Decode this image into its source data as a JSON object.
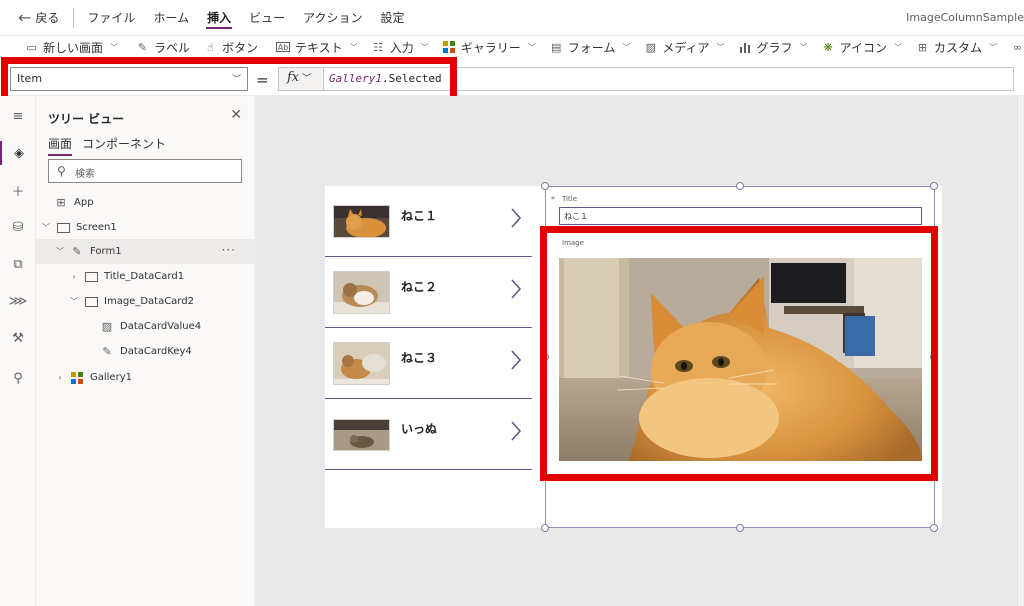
{
  "topbar": {
    "back_label": "戻る",
    "menu": [
      "ファイル",
      "ホーム",
      "挿入",
      "ビュー",
      "アクション",
      "設定"
    ],
    "active_menu": "挿入",
    "app_name": "ImageColumnSample"
  },
  "ribbon": {
    "new_screen": "新しい画面",
    "label": "ラベル",
    "button": "ボタン",
    "text": "テキスト",
    "input": "入力",
    "gallery": "ギャラリー",
    "form": "フォーム",
    "media": "メディア",
    "chart": "グラフ",
    "icon": "アイコン",
    "custom": "カスタム"
  },
  "formula_bar": {
    "property": "Item",
    "equals": "=",
    "fx": "fx",
    "formula_object": "Gallery1",
    "formula_rest": ".Selected"
  },
  "tree_view": {
    "title": "ツリー ビュー",
    "tab_screens": "画面",
    "tab_components": "コンポーネント",
    "search_placeholder": "検索",
    "nodes": {
      "app": "App",
      "screen1": "Screen1",
      "form1": "Form1",
      "title_card": "Title_DataCard1",
      "image_card": "Image_DataCard2",
      "value4": "DataCardValue4",
      "key4": "DataCardKey4",
      "gallery1": "Gallery1"
    },
    "more": "···"
  },
  "gallery": {
    "items": [
      "ねこ１",
      "ねこ２",
      "ねこ３",
      "いっぬ"
    ]
  },
  "form": {
    "title_label": "Title",
    "title_value": "ねこ１",
    "image_label": "Image",
    "required_mark": "*"
  },
  "colors": {
    "accent": "#742774",
    "highlight": "#e00000",
    "gallery_divider": "#5b5b8c"
  }
}
